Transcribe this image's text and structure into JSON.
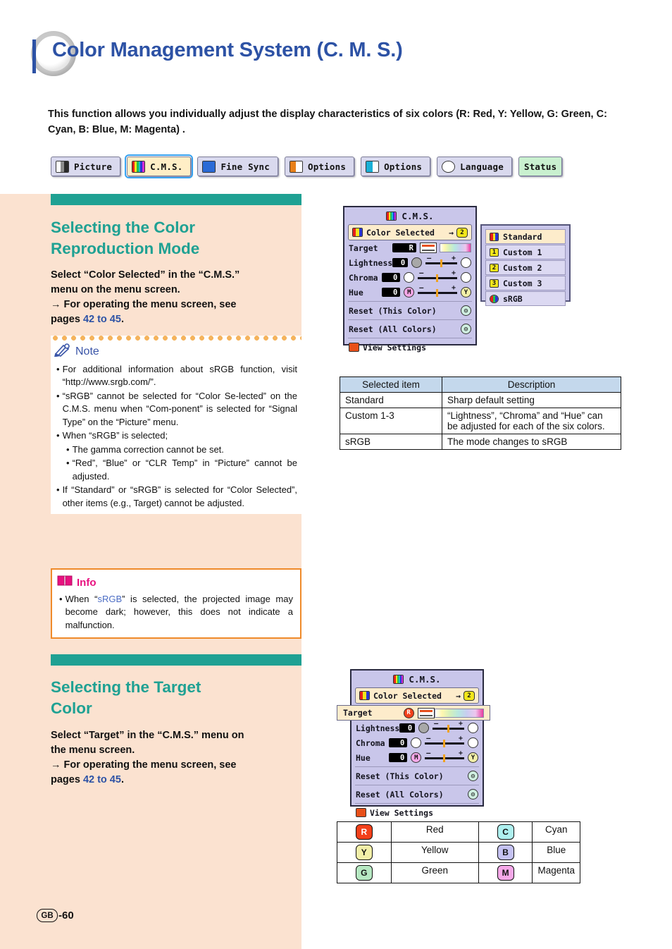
{
  "page": {
    "title": "Color Management System (C. M. S.)",
    "intro": "This function allows you individually adjust the display characteristics of six colors (R: Red, Y: Yellow, G: Green, C: Cyan, B: Blue, M: Magenta) .",
    "footer_region": "GB",
    "footer_page": "-60",
    "accent_teal": "#1fa193",
    "accent_blue": "#2d52a5",
    "accent_magenta": "#e8117f",
    "accent_orange": "#ef8a2a",
    "background_peach": "#fbe2d0"
  },
  "tabs": [
    {
      "label": "Picture",
      "icon": "picture-icon",
      "selected": false
    },
    {
      "label": "C.M.S.",
      "icon": "cms-icon",
      "selected": true
    },
    {
      "label": "Fine Sync",
      "icon": "fine-sync-icon",
      "selected": false
    },
    {
      "label": "Options",
      "icon": "options-1-icon",
      "selected": false
    },
    {
      "label": "Options",
      "icon": "options-2-icon",
      "selected": false
    },
    {
      "label": "Language",
      "icon": "language-icon",
      "selected": false
    },
    {
      "label": "Status",
      "icon": "status-icon",
      "selected": false
    }
  ],
  "section1": {
    "title_line1": "Selecting the Color",
    "title_line2": "Reproduction Mode",
    "body_line1": "Select “Color Selected” in the “C.M.S.”",
    "body_line2": "menu on the menu screen.",
    "body_line3_pre": "→ For operating the menu screen, see",
    "body_line4_pre": "pages ",
    "body_line4_link": "42 to 45",
    "body_line4_post": "."
  },
  "note": {
    "label": "Note",
    "icon": "pencil-icon",
    "items": [
      "For additional information about sRGB function, visit “http://www.srgb.com/”.",
      "“sRGB” cannot be selected for “Color Se-lected” on the C.M.S. menu when “Com-ponent” is selected for “Signal Type” on the “Picture” menu.",
      "When “sRGB” is selected;"
    ],
    "subitems": [
      "The gamma correction cannot be set.",
      "“Red”, “Blue” or “CLR Temp” in “Picture” cannot be adjusted."
    ],
    "last_item": "If “Standard” or “sRGB” is selected for “Color Selected”, other items (e.g., Target) cannot be adjusted."
  },
  "info": {
    "label": "Info",
    "icon": "book-icon",
    "text_pre": "When “",
    "text_link": "sRGB",
    "text_post": "” is selected, the projected image may become dark; however, this does not indicate a malfunction."
  },
  "section2": {
    "title_line1": "Selecting the Target",
    "title_line2": "Color",
    "body_line1": "Select “Target” in the “C.M.S.” menu on",
    "body_line2": "the menu screen.",
    "body_line3_pre": "→ For operating the menu screen, see",
    "body_line4_pre": "pages ",
    "body_line4_link": "42 to 45",
    "body_line4_post": "."
  },
  "osd1": {
    "title": "C.M.S.",
    "banner_label": "Color Selected",
    "banner_value_icon": "custom-2-icon",
    "banner_arrow": "→",
    "rows": [
      {
        "label": "Target",
        "value": "R",
        "left_icon": "target-swatch-icon",
        "right_icon": "color-band-icon"
      },
      {
        "label": "Lightness",
        "value": "0",
        "left_icon": "lightness-low-icon",
        "right_icon": "lightness-high-icon"
      },
      {
        "label": "Chroma",
        "value": "0",
        "left_icon": "chroma-low-icon",
        "right_icon": "chroma-high-icon"
      },
      {
        "label": "Hue",
        "value": "0",
        "left_icon": "hue-magenta-icon",
        "right_icon": "hue-yellow-icon"
      }
    ],
    "reset_this": "Reset (This Color)",
    "reset_all": "Reset (All Colors)",
    "view_settings": "View Settings"
  },
  "osd_dropdown": {
    "items": [
      {
        "label": "Standard",
        "icon": "standard-icon",
        "selected": true
      },
      {
        "label": "Custom 1",
        "icon": "custom-1-icon",
        "selected": false
      },
      {
        "label": "Custom 2",
        "icon": "custom-2-icon",
        "selected": false
      },
      {
        "label": "Custom 3",
        "icon": "custom-3-icon",
        "selected": false
      },
      {
        "label": "sRGB",
        "icon": "srgb-icon",
        "selected": false
      }
    ]
  },
  "osd2": {
    "title": "C.M.S.",
    "banner_label": "Color Selected",
    "banner_arrow": "→",
    "target_label": "Target",
    "target_value_icon": "red-badge-icon",
    "rows": [
      {
        "label": "Lightness",
        "value": "0"
      },
      {
        "label": "Chroma",
        "value": "0"
      },
      {
        "label": "Hue",
        "value": "0"
      }
    ],
    "reset_this": "Reset (This Color)",
    "reset_all": "Reset (All Colors)",
    "view_settings": "View Settings"
  },
  "mode_table": {
    "headers": [
      "Selected item",
      "Description"
    ],
    "rows": [
      [
        "Standard",
        "Sharp default setting"
      ],
      [
        "Custom 1-3",
        "“Lightness”, “Chroma” and “Hue” can be adjusted for each of the six colors."
      ],
      [
        "sRGB",
        "The mode changes to sRGB"
      ]
    ]
  },
  "color_table": {
    "rows": [
      {
        "left_badge": "R",
        "left_label": "Red",
        "left_color": "#f2401a",
        "right_badge": "C",
        "right_label": "Cyan",
        "right_color": "#aef0ef"
      },
      {
        "left_badge": "Y",
        "left_label": "Yellow",
        "left_color": "#f2efa8",
        "right_badge": "B",
        "right_label": "Blue",
        "right_color": "#c5c2f2"
      },
      {
        "left_badge": "G",
        "left_label": "Green",
        "left_color": "#b6e8c2",
        "right_badge": "M",
        "right_label": "Magenta",
        "right_color": "#f5a8e8"
      }
    ]
  }
}
